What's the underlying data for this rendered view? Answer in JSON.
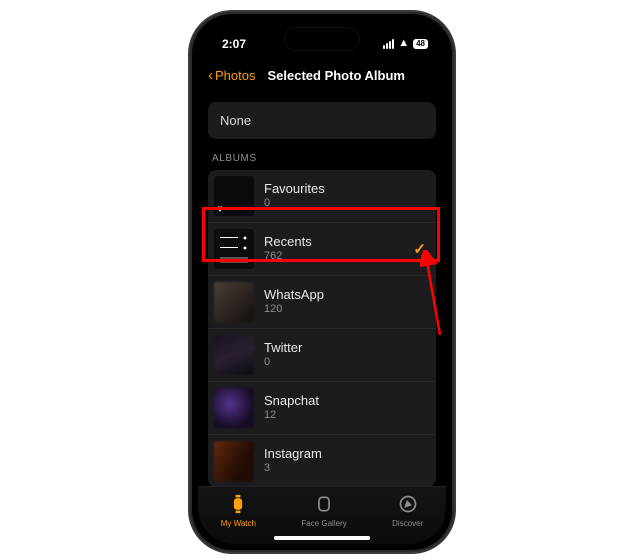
{
  "status": {
    "time": "2:07",
    "battery": "48"
  },
  "nav": {
    "back_label": "Photos",
    "title": "Selected Photo Album"
  },
  "none_label": "None",
  "section_header": "ALBUMS",
  "albums": [
    {
      "name": "Favourites",
      "count": "0",
      "selected": false,
      "thumb": "fav"
    },
    {
      "name": "Recents",
      "count": "762",
      "selected": true,
      "thumb": "recents"
    },
    {
      "name": "WhatsApp",
      "count": "120",
      "selected": false,
      "thumb": "blur1"
    },
    {
      "name": "Twitter",
      "count": "0",
      "selected": false,
      "thumb": "blur2"
    },
    {
      "name": "Snapchat",
      "count": "12",
      "selected": false,
      "thumb": "blur3"
    },
    {
      "name": "Instagram",
      "count": "3",
      "selected": false,
      "thumb": "blur4"
    }
  ],
  "tabs": [
    {
      "label": "My Watch",
      "icon": "watch",
      "active": true
    },
    {
      "label": "Face Gallery",
      "icon": "face",
      "active": false
    },
    {
      "label": "Discover",
      "icon": "compass",
      "active": false
    }
  ],
  "annotations": {
    "highlight_row_index": 1,
    "colors": {
      "accent": "#ff9f0a",
      "annotation": "#ff0000"
    }
  }
}
